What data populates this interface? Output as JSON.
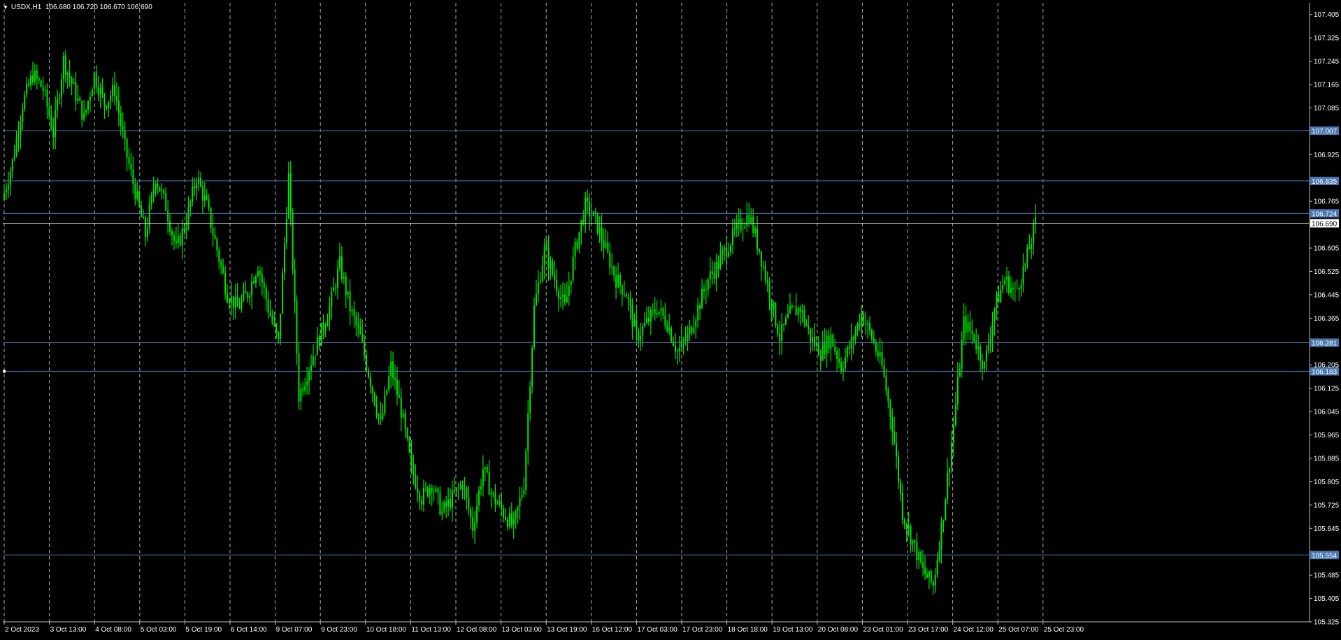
{
  "header": {
    "symbol": "USDX,H1",
    "ohlc": "106.680 106.720 106.670 106.690"
  },
  "colors": {
    "background": "#000000",
    "candles": "#00e600",
    "grid": "#c8c8c8",
    "levels": "#4a78b0",
    "level_label_bg": "#4a78b0",
    "current_label_bg": "#ffffff"
  },
  "chart_data": {
    "type": "candlestick",
    "ylim": [
      105.325,
      107.445
    ],
    "y_ticks": [
      "107.405",
      "107.325",
      "107.245",
      "107.165",
      "107.085",
      "106.925",
      "106.765",
      "106.605",
      "106.525",
      "106.445",
      "106.365",
      "106.205",
      "106.125",
      "106.045",
      "105.965",
      "105.885",
      "105.805",
      "105.725",
      "105.645",
      "105.485",
      "105.405",
      "105.325"
    ],
    "x_ticks": [
      "2 Oct 2023",
      "3 Oct 13:00",
      "4 Oct 08:00",
      "5 Oct 03:00",
      "5 Oct 19:00",
      "6 Oct 14:00",
      "9 Oct 07:00",
      "9 Oct 23:00",
      "10 Oct 18:00",
      "11 Oct 13:00",
      "12 Oct 08:00",
      "13 Oct 03:00",
      "13 Oct 19:00",
      "16 Oct 12:00",
      "17 Oct 03:00",
      "17 Oct 23:00",
      "18 Oct 18:00",
      "19 Oct 13:00",
      "20 Oct 08:00",
      "23 Oct 01:00",
      "23 Oct 17:00",
      "24 Oct 12:00",
      "25 Oct 07:00",
      "25 Oct 23:00"
    ],
    "horizontal_levels": [
      "107.007",
      "106.835",
      "106.724",
      "106.281",
      "106.183",
      "105.554"
    ],
    "current_price": "106.690",
    "series": [
      {
        "name": "USDX,H1",
        "close_path": [
          106.77,
          106.9,
          107.1,
          107.2,
          107.15,
          107.0,
          107.25,
          107.15,
          107.05,
          107.2,
          107.1,
          107.15,
          106.95,
          106.8,
          106.65,
          106.85,
          106.75,
          106.6,
          106.7,
          106.85,
          106.75,
          106.6,
          106.45,
          106.4,
          106.45,
          106.55,
          106.4,
          106.28,
          106.85,
          106.1,
          106.2,
          106.3,
          106.4,
          106.55,
          106.4,
          106.3,
          106.15,
          106.0,
          106.2,
          106.05,
          105.85,
          105.75,
          105.8,
          105.7,
          105.75,
          105.8,
          105.65,
          105.85,
          105.75,
          105.7,
          105.65,
          105.8,
          106.4,
          106.6,
          106.5,
          106.4,
          106.6,
          106.75,
          106.7,
          106.6,
          106.5,
          106.45,
          106.3,
          106.35,
          106.4,
          106.35,
          106.25,
          106.3,
          106.4,
          106.5,
          106.55,
          106.62,
          106.68,
          106.72,
          106.6,
          106.45,
          106.3,
          106.38,
          106.4,
          106.3,
          106.25,
          106.3,
          106.2,
          106.28,
          106.38,
          106.3,
          106.2,
          106.0,
          105.7,
          105.6,
          105.5,
          105.45,
          105.7,
          106.0,
          106.35,
          106.3,
          106.2,
          106.4,
          106.5,
          106.45,
          106.55,
          106.69
        ],
        "last_bar_ohlc": [
          106.68,
          106.72,
          106.67,
          106.69
        ]
      }
    ]
  }
}
